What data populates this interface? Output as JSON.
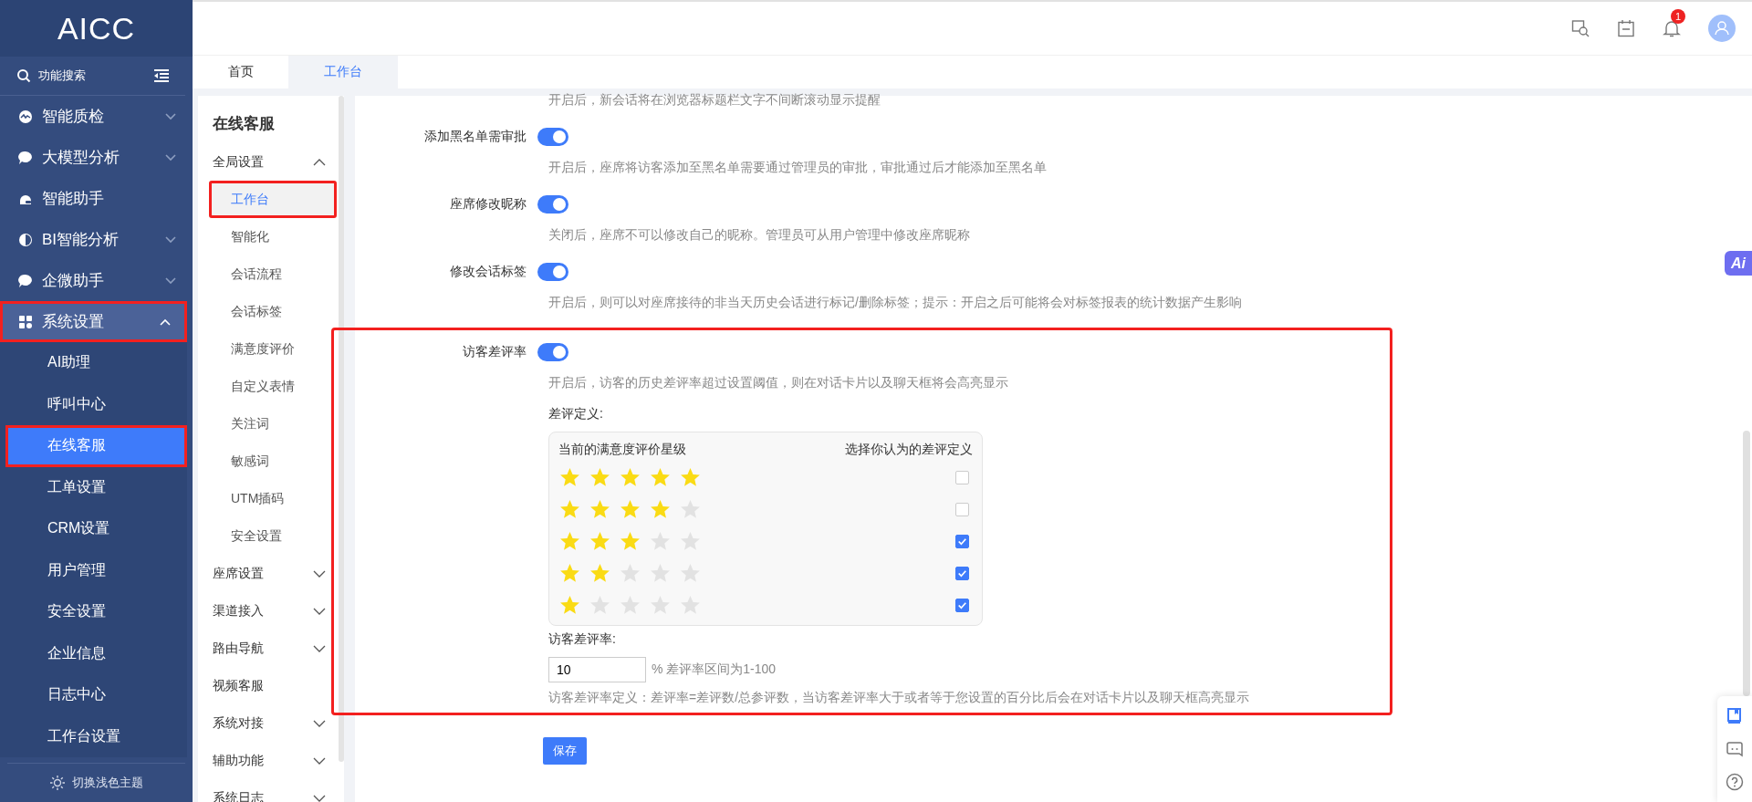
{
  "brand": "AICC",
  "sidebar": {
    "search_label": "功能搜索",
    "items": [
      {
        "label": "智能质检",
        "expandable": true,
        "expanded": false,
        "marked": false
      },
      {
        "label": "大模型分析",
        "expandable": true,
        "expanded": false,
        "marked": false
      },
      {
        "label": "智能助手",
        "expandable": false,
        "expanded": false,
        "marked": false
      },
      {
        "label": "BI智能分析",
        "expandable": true,
        "expanded": false,
        "marked": false
      },
      {
        "label": "企微助手",
        "expandable": true,
        "expanded": false,
        "marked": false
      },
      {
        "label": "系统设置",
        "expandable": true,
        "expanded": true,
        "marked": true,
        "children": [
          {
            "label": "AI助理",
            "selected": false,
            "marked": false
          },
          {
            "label": "呼叫中心",
            "selected": false,
            "marked": false
          },
          {
            "label": "在线客服",
            "selected": true,
            "marked": true
          },
          {
            "label": "工单设置",
            "selected": false,
            "marked": false
          },
          {
            "label": "CRM设置",
            "selected": false,
            "marked": false
          },
          {
            "label": "用户管理",
            "selected": false,
            "marked": false
          },
          {
            "label": "安全设置",
            "selected": false,
            "marked": false
          },
          {
            "label": "企业信息",
            "selected": false,
            "marked": false
          },
          {
            "label": "日志中心",
            "selected": false,
            "marked": false
          },
          {
            "label": "工作台设置",
            "selected": false,
            "marked": false
          }
        ]
      }
    ],
    "theme_label": "切换浅色主题"
  },
  "header": {
    "notification_count": "1"
  },
  "tabs": [
    {
      "label": "首页",
      "selected": false
    },
    {
      "label": "工作台",
      "selected": true
    }
  ],
  "subnav": {
    "title": "在线客服",
    "groups": [
      {
        "label": "全局设置",
        "expandable": true,
        "expanded": true,
        "children": [
          {
            "label": "工作台",
            "selected": true,
            "marked": true
          },
          {
            "label": "智能化",
            "selected": false,
            "marked": false
          },
          {
            "label": "会话流程",
            "selected": false,
            "marked": false
          },
          {
            "label": "会话标签",
            "selected": false,
            "marked": false
          },
          {
            "label": "满意度评价",
            "selected": false,
            "marked": false
          },
          {
            "label": "自定义表情",
            "selected": false,
            "marked": false
          },
          {
            "label": "关注词",
            "selected": false,
            "marked": false
          },
          {
            "label": "敏感词",
            "selected": false,
            "marked": false
          },
          {
            "label": "UTM插码",
            "selected": false,
            "marked": false
          },
          {
            "label": "安全设置",
            "selected": false,
            "marked": false
          }
        ]
      },
      {
        "label": "座席设置",
        "expandable": true,
        "expanded": false
      },
      {
        "label": "渠道接入",
        "expandable": true,
        "expanded": false
      },
      {
        "label": "路由导航",
        "expandable": true,
        "expanded": false
      },
      {
        "label": "视频客服",
        "expandable": false
      },
      {
        "label": "系统对接",
        "expandable": true,
        "expanded": false
      },
      {
        "label": "辅助功能",
        "expandable": true,
        "expanded": false
      },
      {
        "label": "系统日志",
        "expandable": true,
        "expanded": false
      }
    ]
  },
  "settings": {
    "top_description": "开启后，新会话将在浏览器标题栏文字不间断滚动显示提醒",
    "rows": [
      {
        "label": "添加黑名单需审批",
        "on": true,
        "description": "开启后，座席将访客添加至黑名单需要通过管理员的审批，审批通过后才能添加至黑名单",
        "marked": false
      },
      {
        "label": "座席修改昵称",
        "on": true,
        "description": "关闭后，座席不可以修改自己的昵称。管理员可从用户管理中修改座席昵称",
        "marked": false
      },
      {
        "label": "修改会话标签",
        "on": true,
        "description": "开启后，则可以对座席接待的非当天历史会话进行标记/删除标签；提示：开启之后可能将会对标签报表的统计数据产生影响",
        "marked": false
      },
      {
        "label": "访客差评率",
        "on": true,
        "description": "开启后，访客的历史差评率超过设置阈值，则在对话卡片以及聊天框将会高亮显示",
        "marked": true
      }
    ]
  },
  "bad_review": {
    "title": "差评定义:",
    "col_left": "当前的满意度评价星级",
    "col_right": "选择你认为的差评定义",
    "levels": [
      {
        "stars": 5,
        "checked": false
      },
      {
        "stars": 4,
        "checked": false
      },
      {
        "stars": 3,
        "checked": true
      },
      {
        "stars": 2,
        "checked": true
      },
      {
        "stars": 1,
        "checked": true
      }
    ],
    "rate_label": "访客差评率:",
    "rate_value": "10",
    "rate_hint": "% 差评率区间为1-100",
    "definition": "访客差评率定义：差评率=差评数/总参评数，当访客差评率大于或者等于您设置的百分比后会在对话卡片以及聊天框高亮显示"
  },
  "save_label": "保存",
  "ai_button": "Ai"
}
